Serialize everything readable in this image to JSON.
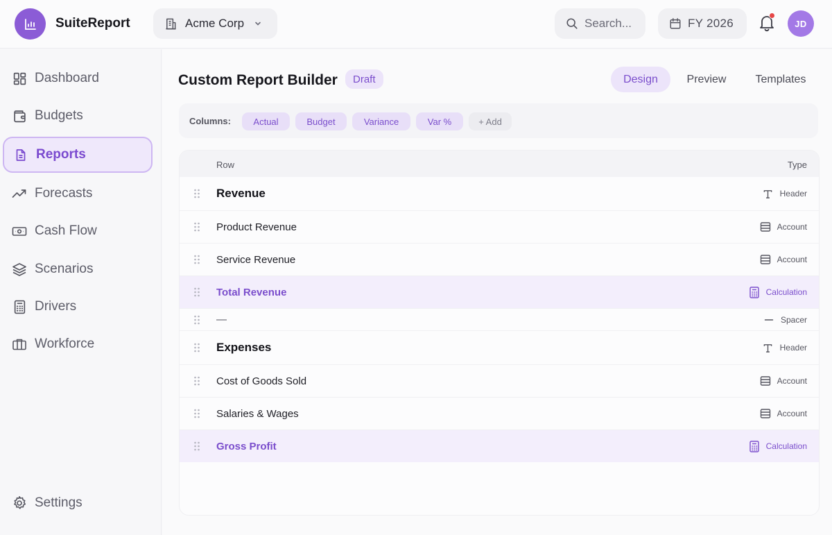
{
  "app": {
    "name": "SuiteReport"
  },
  "header": {
    "org_name": "Acme Corp",
    "search_placeholder": "Search...",
    "fiscal_year": "FY 2026",
    "user_initials": "JD",
    "notification_dot_color": "#e64646"
  },
  "sidebar": {
    "items": [
      {
        "label": "Dashboard",
        "icon": "grid-icon"
      },
      {
        "label": "Budgets",
        "icon": "wallet-icon"
      },
      {
        "label": "Reports",
        "icon": "document-icon",
        "active": true
      },
      {
        "label": "Forecasts",
        "icon": "trend-up-icon"
      },
      {
        "label": "Cash Flow",
        "icon": "cash-icon"
      },
      {
        "label": "Scenarios",
        "icon": "layers-icon"
      },
      {
        "label": "Drivers",
        "icon": "calculator-icon"
      },
      {
        "label": "Workforce",
        "icon": "briefcase-icon"
      }
    ],
    "settings_label": "Settings"
  },
  "page": {
    "title": "Custom Report Builder",
    "status_badge": "Draft",
    "view_tabs": [
      {
        "label": "Design",
        "active": true
      },
      {
        "label": "Preview"
      },
      {
        "label": "Templates"
      }
    ]
  },
  "columns": {
    "label": "Columns:",
    "chips": [
      "Actual",
      "Budget",
      "Variance",
      "Var %"
    ],
    "add_label": "+ Add"
  },
  "table": {
    "headers": {
      "row": "Row",
      "type": "Type"
    },
    "rows": [
      {
        "label": "Revenue",
        "type": "Header"
      },
      {
        "label": "Product Revenue",
        "type": "Account"
      },
      {
        "label": "Service Revenue",
        "type": "Account"
      },
      {
        "label": "Total Revenue",
        "type": "Calculation"
      },
      {
        "label": "—",
        "type": "Spacer"
      },
      {
        "label": "Expenses",
        "type": "Header"
      },
      {
        "label": "Cost of Goods Sold",
        "type": "Account"
      },
      {
        "label": "Salaries & Wages",
        "type": "Account"
      },
      {
        "label": "Gross Profit",
        "type": "Calculation"
      }
    ]
  },
  "colors": {
    "accent": "#8b5cd6",
    "accent_text": "#7a4dcc",
    "accent_soft": "#ece4fa",
    "calc_row_bg": "#f3eefc"
  }
}
